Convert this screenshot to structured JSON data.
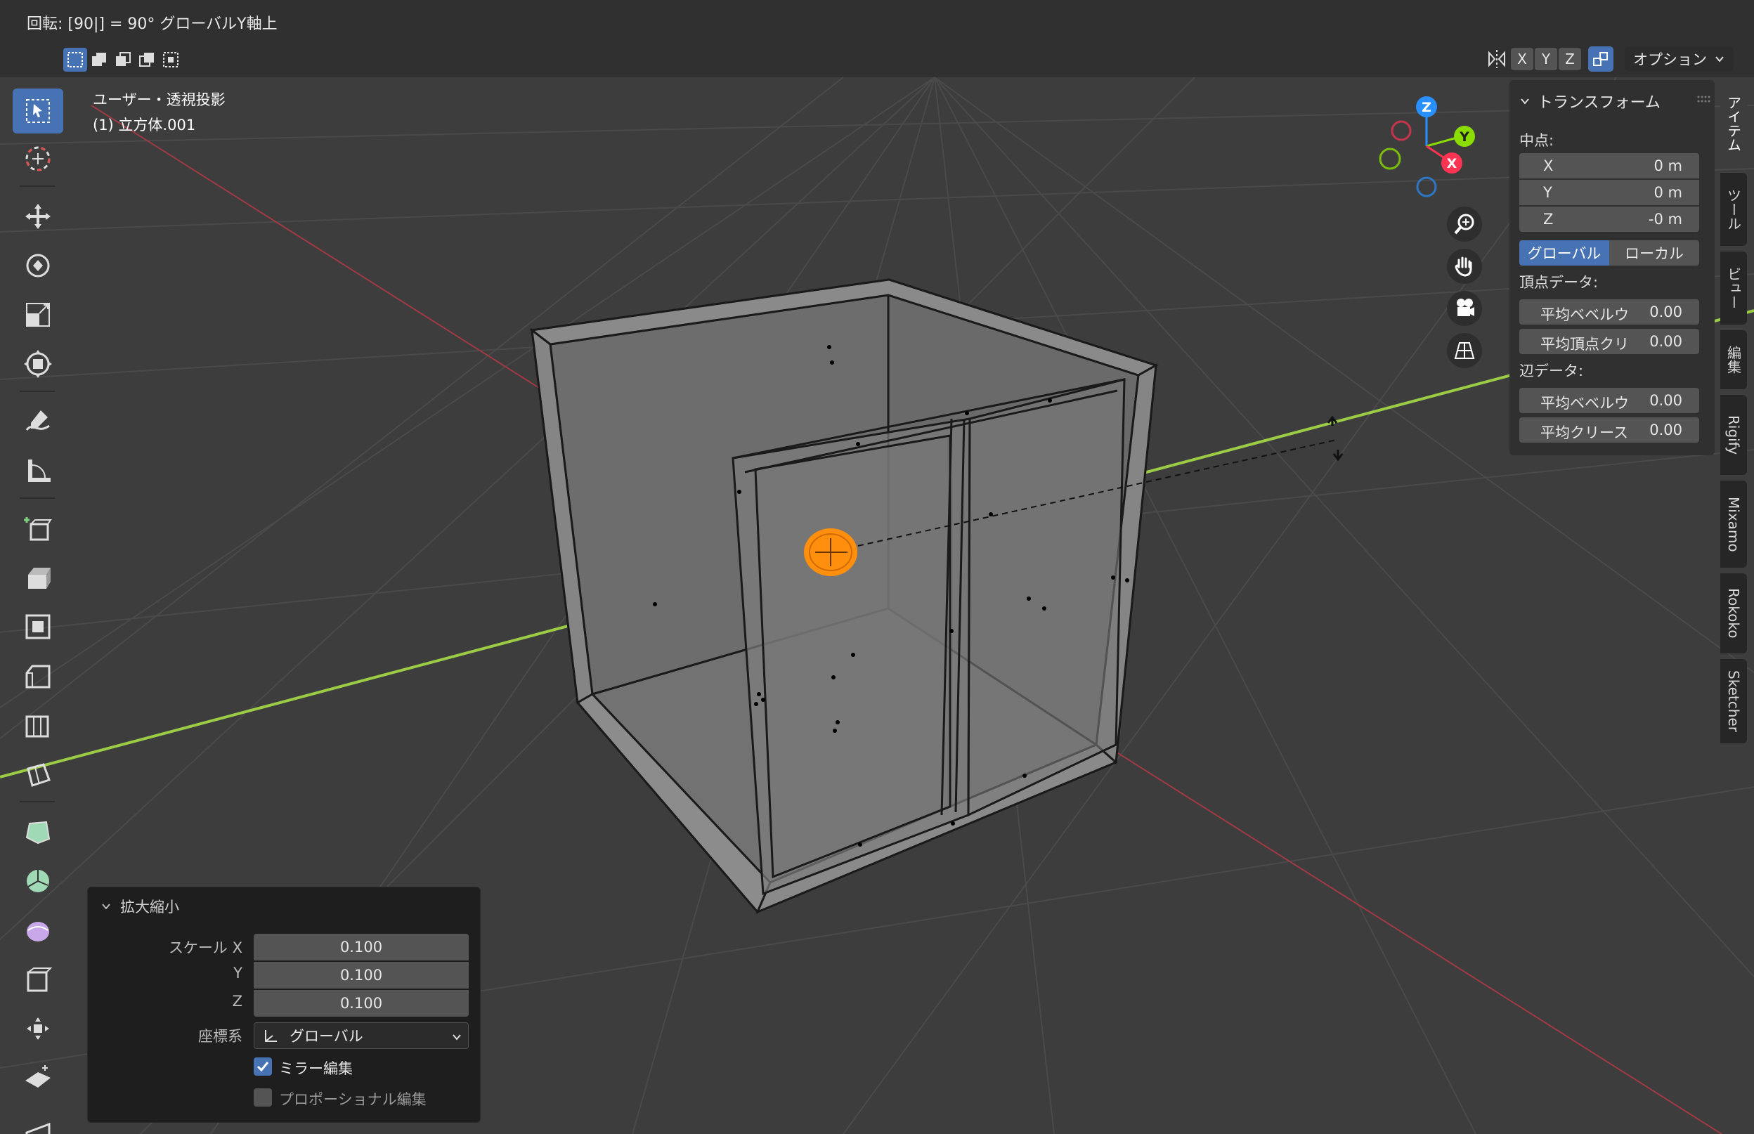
{
  "header": {
    "operator_status": "回転: [90|] = 90°  グローバルY軸上"
  },
  "select_modes": [
    "select-new-icon",
    "select-extend-icon",
    "select-subtract-icon",
    "select-invert-icon",
    "select-intersect-icon"
  ],
  "viewport": {
    "title": "ユーザー・透視投影",
    "object": "(1) 立方体.001",
    "axis_colors": {
      "x": "#ff3352",
      "y": "#8bdc00",
      "z": "#2890ff"
    },
    "selection_color": "#ff8f0d"
  },
  "toolbar": {
    "tools": [
      {
        "name": "select-box-icon",
        "active": true
      },
      {
        "name": "cursor-icon"
      },
      {
        "name": "move-icon"
      },
      {
        "name": "rotate-icon"
      },
      {
        "name": "scale-icon"
      },
      {
        "name": "transform-icon"
      },
      {
        "name": "annotate-icon"
      },
      {
        "name": "measure-icon"
      },
      {
        "name": "add-cube-icon"
      },
      {
        "name": "extrude-icon"
      },
      {
        "name": "inset-icon"
      },
      {
        "name": "bevel-icon"
      },
      {
        "name": "loop-cut-icon"
      },
      {
        "name": "knife-icon"
      },
      {
        "name": "poly-build-icon"
      },
      {
        "name": "spin-icon"
      },
      {
        "name": "smooth-icon"
      },
      {
        "name": "edge-slide-icon"
      },
      {
        "name": "shrink-fatten-icon"
      },
      {
        "name": "shear-icon"
      },
      {
        "name": "rip-icon"
      }
    ]
  },
  "header_right": {
    "axes": [
      "X",
      "Y",
      "Z"
    ],
    "options_label": "オプション"
  },
  "gizmo": {
    "z": "Z",
    "y": "Y",
    "x": "X"
  },
  "npanel": {
    "title": "トランスフォーム",
    "median_label": "中点:",
    "median": [
      {
        "axis": "X",
        "value": "0 m"
      },
      {
        "axis": "Y",
        "value": "0 m"
      },
      {
        "axis": "Z",
        "value": "-0 m"
      }
    ],
    "space_global": "グローバル",
    "space_local": "ローカル",
    "vertex_data_label": "頂点データ:",
    "vertex_data": [
      {
        "label": "平均ベベルウ",
        "value": "0.00"
      },
      {
        "label": "平均頂点クリ",
        "value": "0.00"
      }
    ],
    "edge_data_label": "辺データ:",
    "edge_data": [
      {
        "label": "平均ベベルウ",
        "value": "0.00"
      },
      {
        "label": "平均クリース",
        "value": "0.00"
      }
    ]
  },
  "sidetabs": [
    "アイテム",
    "ツール",
    "ビュー",
    "編集",
    "Rigify",
    "Mixamo",
    "Rokoko",
    "Sketcher"
  ],
  "operator_panel": {
    "title": "拡大縮小",
    "scale_label": "スケール X",
    "y_label": "Y",
    "z_label": "Z",
    "scale": [
      "0.100",
      "0.100",
      "0.100"
    ],
    "orientation_label": "座標系",
    "orientation_value": "グローバル",
    "mirror_label": "ミラー編集",
    "mirror_checked": true,
    "proportional_label": "プロポーショナル編集",
    "proportional_checked": false
  }
}
